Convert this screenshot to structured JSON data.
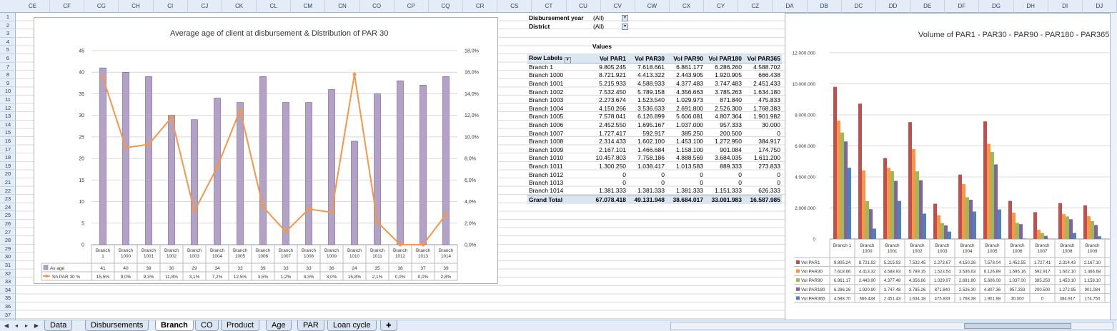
{
  "columns": [
    "CE",
    "CF",
    "CG",
    "CH",
    "CI",
    "CJ",
    "CK",
    "CL",
    "CM",
    "CN",
    "CO",
    "CP",
    "CQ",
    "CR",
    "CS",
    "CT",
    "CU",
    "CV",
    "CW",
    "CX",
    "CY",
    "CZ",
    "DA",
    "DB",
    "DC",
    "DD",
    "DE",
    "DF",
    "DG",
    "DH",
    "DI",
    "DJ"
  ],
  "rows": [
    "1",
    "2",
    "3",
    "4",
    "5",
    "6",
    "7",
    "8",
    "9",
    "10",
    "11",
    "12",
    "13",
    "14",
    "15",
    "16",
    "17",
    "18",
    "19",
    "20",
    "21",
    "22",
    "23",
    "24",
    "25",
    "26",
    "27",
    "28",
    "29",
    "30",
    "31",
    "32",
    "33",
    "34",
    "35",
    "36",
    "37"
  ],
  "chart_data": [
    {
      "type": "bar",
      "title": "Average age of client at disbursement & Distribution of PAR 30",
      "categories": [
        "Branch 1",
        "Branch 1000",
        "Branch 1001",
        "Branch 1002",
        "Branch 1003",
        "Branch 1004",
        "Branch 1005",
        "Branch 1006",
        "Branch 1007",
        "Branch 1008",
        "Branch 1009",
        "Branch 1010",
        "Branch 1011",
        "Branch 1012",
        "Branch 1013",
        "Branch 1014"
      ],
      "category_lines": [
        [
          "Branch",
          "1"
        ],
        [
          "Branch",
          "1000"
        ],
        [
          "Branch",
          "1001"
        ],
        [
          "Branch",
          "1002"
        ],
        [
          "Branch",
          "1003"
        ],
        [
          "Branch",
          "1004"
        ],
        [
          "Branch",
          "1005"
        ],
        [
          "Branch",
          "1006"
        ],
        [
          "Branch",
          "1007"
        ],
        [
          "Branch",
          "1008"
        ],
        [
          "Branch",
          "1009"
        ],
        [
          "Branch",
          "1010"
        ],
        [
          "Branch",
          "1011"
        ],
        [
          "Branch",
          "1012"
        ],
        [
          "Branch",
          "1013"
        ],
        [
          "Branch",
          "1014"
        ]
      ],
      "ylim": [
        0,
        45
      ],
      "y_ticks": [
        "0",
        "5",
        "10",
        "15",
        "20",
        "25",
        "30",
        "35",
        "40",
        "45"
      ],
      "y2lim": [
        0,
        18
      ],
      "y2_ticks": [
        "0,0%",
        "2,0%",
        "4,0%",
        "6,0%",
        "8,0%",
        "10,0%",
        "12,0%",
        "14,0%",
        "16,0%",
        "18,0%"
      ],
      "series": [
        {
          "name": "Av age",
          "kind": "bar",
          "color": "#b3a2c7",
          "values": [
            41,
            40,
            39,
            30,
            29,
            34,
            33,
            39,
            33,
            33,
            36,
            24,
            35,
            38,
            37,
            39
          ],
          "labels": [
            "41",
            "40",
            "39",
            "30",
            "29",
            "34",
            "33",
            "39",
            "33",
            "33",
            "36",
            "24",
            "35",
            "38",
            "37",
            "39"
          ]
        },
        {
          "name": "Sh PAR 30 %",
          "kind": "line",
          "axis": "secondary",
          "color": "#f79646",
          "values": [
            15.5,
            9.0,
            9.3,
            11.8,
            3.1,
            7.2,
            12.5,
            3.5,
            1.2,
            3.3,
            3.0,
            15.8,
            2.1,
            0.0,
            0.0,
            2.8
          ],
          "labels": [
            "15,5%",
            "9,0%",
            "9,3%",
            "11,8%",
            "3,1%",
            "7,2%",
            "12,5%",
            "3,5%",
            "1,2%",
            "3,3%",
            "3,0%",
            "15,8%",
            "2,1%",
            "0,0%",
            "0,0%",
            "2,8%"
          ]
        }
      ],
      "grid": true
    },
    {
      "type": "bar",
      "title": "Volume of PAR1 - PAR30 - PAR90 - PAR180 - PAR365",
      "categories": [
        "Branch 1",
        "Branch 1000",
        "Branch 1001",
        "Branch 1002",
        "Branch 1003",
        "Branch 1004",
        "Branch 1005",
        "Branch 1006",
        "Branch 1007",
        "Branch 1008",
        "Branch 1009"
      ],
      "category_lines": [
        [
          "Branch 1"
        ],
        [
          "Branch",
          "1000"
        ],
        [
          "Branch",
          "1001"
        ],
        [
          "Branch",
          "1002"
        ],
        [
          "Branch",
          "1003"
        ],
        [
          "Branch",
          "1004"
        ],
        [
          "Branch",
          "1005"
        ],
        [
          "Branch",
          "1006"
        ],
        [
          "Branch",
          "1007"
        ],
        [
          "Branch",
          "1008"
        ],
        [
          "Branch",
          "1009"
        ]
      ],
      "ylim": [
        0,
        12000000
      ],
      "y_ticks": [
        "0",
        "2.000.000",
        "4.000.000",
        "6.000.000",
        "8.000.000",
        "10.000.000",
        "12.000.000"
      ],
      "series": [
        {
          "name": "Vol PAR1",
          "color": "#c0504d",
          "values": [
            9805245,
            8721921,
            5215933,
            7532450,
            2273674,
            4150266,
            7578041,
            2452550,
            1727417,
            2314433,
            2167101
          ],
          "labels": [
            "9.805.24",
            "8.721.92",
            "5.215.93",
            "7.532.45",
            "2.273.67",
            "4.150.26",
            "7.578.04",
            "2.452.55",
            "1.727.41",
            "2.314.43",
            "2.167.10"
          ]
        },
        {
          "name": "Vol PAR30",
          "color": "#f79646",
          "values": [
            7618661,
            4413322,
            4588933,
            5789158,
            1523540,
            3536633,
            6126899,
            1695167,
            592917,
            1602100,
            1466688
          ],
          "labels": [
            "7.618.66",
            "4.413.32",
            "4.588.93",
            "5.789.15",
            "1.523.54",
            "3.536.63",
            "6.126.89",
            "1.695.16",
            "592.917",
            "1.602.10",
            "1.466.68"
          ]
        },
        {
          "name": "Vol PAR90",
          "color": "#9bbb59",
          "values": [
            6861177,
            2443905,
            4377483,
            4356663,
            1029973,
            2691800,
            5606081,
            1037000,
            385250,
            1453100,
            1158100
          ],
          "labels": [
            "6.861.17",
            "2.443.90",
            "4.377.48",
            "4.356.66",
            "1.029.97",
            "2.691.80",
            "5.606.08",
            "1.037.00",
            "385.250",
            "1.453.10",
            "1.158.10"
          ]
        },
        {
          "name": "Vol PAR180",
          "color": "#8064a2",
          "values": [
            6286260,
            1920905,
            3747483,
            3785263,
            871840,
            2526300,
            4807364,
            957333,
            200500,
            1272950,
            901084
          ],
          "labels": [
            "6.286.26",
            "1.920.90",
            "3.747.48",
            "3.785.26",
            "871.840",
            "2.526.30",
            "4.807.36",
            "957.333",
            "200.500",
            "1.272.95",
            "901.084"
          ]
        },
        {
          "name": "Vol PAR365",
          "color": "#4f81bd",
          "values": [
            4588702,
            666438,
            2451433,
            1634180,
            475833,
            1768383,
            1901982,
            30000,
            0,
            384917,
            174750
          ],
          "labels": [
            "4.588.70",
            "666.438",
            "2.451.43",
            "1.634.18",
            "475.833",
            "1.768.38",
            "1.901.98",
            "30.000",
            "0",
            "384.917",
            "174.750"
          ]
        }
      ],
      "grid": true,
      "legend": "data-table"
    }
  ],
  "pivot": {
    "filters": [
      {
        "label": "Disbursement year",
        "value": "(All)"
      },
      {
        "label": "District",
        "value": "(All)"
      }
    ],
    "values_caption": "Values",
    "row_labels_header": "Row Labels",
    "headers": [
      "Vol PAR1",
      "Vol PAR30",
      "Vol PAR90",
      "Vol PAR180",
      "Vol PAR365"
    ],
    "rows": [
      {
        "label": "Branch 1",
        "cells": [
          "9.805.245",
          "7.618.661",
          "6.861.177",
          "6.286.260",
          "4.588.702"
        ]
      },
      {
        "label": "Branch 1000",
        "cells": [
          "8.721.921",
          "4.413.322",
          "2.443.905",
          "1.920.905",
          "666.438"
        ]
      },
      {
        "label": "Branch 1001",
        "cells": [
          "5.215.933",
          "4.588.933",
          "4.377.483",
          "3.747.483",
          "2.451.433"
        ]
      },
      {
        "label": "Branch 1002",
        "cells": [
          "7.532.450",
          "5.789.158",
          "4.356.663",
          "3.785.263",
          "1.634.180"
        ]
      },
      {
        "label": "Branch 1003",
        "cells": [
          "2.273.674",
          "1.523.540",
          "1.029.973",
          "871.840",
          "475.833"
        ]
      },
      {
        "label": "Branch 1004",
        "cells": [
          "4.150.266",
          "3.536.633",
          "2.691.800",
          "2.526.300",
          "1.768.383"
        ]
      },
      {
        "label": "Branch 1005",
        "cells": [
          "7.578.041",
          "6.126.899",
          "5.606.081",
          "4.807.364",
          "1.901.982"
        ]
      },
      {
        "label": "Branch 1006",
        "cells": [
          "2.452.550",
          "1.695.167",
          "1.037.000",
          "957.333",
          "30.000"
        ]
      },
      {
        "label": "Branch 1007",
        "cells": [
          "1.727.417",
          "592.917",
          "385.250",
          "200.500",
          "0"
        ]
      },
      {
        "label": "Branch 1008",
        "cells": [
          "2.314.433",
          "1.602.100",
          "1.453.100",
          "1.272.950",
          "384.917"
        ]
      },
      {
        "label": "Branch 1009",
        "cells": [
          "2.167.101",
          "1.466.684",
          "1.158.100",
          "901.084",
          "174.750"
        ]
      },
      {
        "label": "Branch 1010",
        "cells": [
          "10.457.803",
          "7.758.186",
          "4.888.569",
          "3.684.035",
          "1.611.200"
        ]
      },
      {
        "label": "Branch 1011",
        "cells": [
          "1.300.250",
          "1.038.417",
          "1.013.583",
          "889.333",
          "273.833"
        ]
      },
      {
        "label": "Branch 1012",
        "cells": [
          "0",
          "0",
          "0",
          "0",
          "0"
        ]
      },
      {
        "label": "Branch 1013",
        "cells": [
          "0",
          "0",
          "0",
          "0",
          "0"
        ]
      },
      {
        "label": "Branch 1014",
        "cells": [
          "1.381.333",
          "1.381.333",
          "1.381.333",
          "1.151.333",
          "626.333"
        ]
      }
    ],
    "grand": {
      "label": "Grand Total",
      "cells": [
        "67.078.418",
        "49.131.948",
        "38.684.017",
        "33.001.983",
        "16.587.985"
      ]
    }
  },
  "tabs": [
    "Data",
    "Disbursements",
    "Branch",
    "CO",
    "Product",
    "Age",
    "PAR",
    "Loan cycle"
  ],
  "active_tab": "Branch"
}
